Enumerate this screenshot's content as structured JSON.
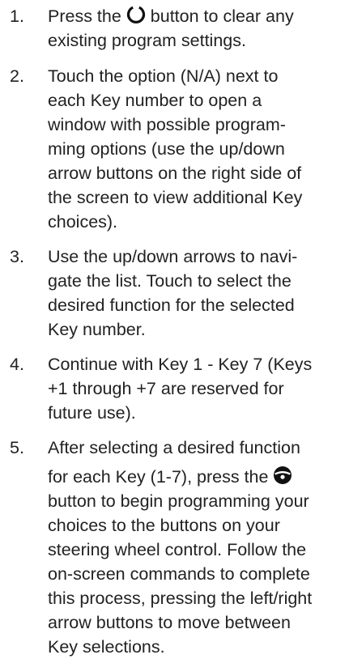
{
  "steps": [
    {
      "number": "1.",
      "before": "Press the",
      "icon": "power-icon",
      "after": "button to clear any",
      "lines": [
        "existing program settings."
      ]
    },
    {
      "number": "2.",
      "lines": [
        "Touch the option (N/A) next to",
        "each Key number to open a",
        "window with possible program-",
        "ming options (use the up/down",
        "arrow buttons on the right side of",
        "the screen to view additional Key",
        "choices)."
      ]
    },
    {
      "number": "3.",
      "lines": [
        "Use the up/down arrows to navi-",
        "gate the list. Touch to select the",
        "desired function for the selected",
        "Key number."
      ]
    },
    {
      "number": "4.",
      "lines": [
        "Continue with Key 1 - Key 7 (Keys",
        "+1 through +7 are reserved for",
        "future use)."
      ]
    },
    {
      "number": "5.",
      "first_line": "After selecting a desired function",
      "before": "for each Key (1-7), press the",
      "icon": "steering-wheel-icon",
      "lines": [
        "button to begin programming your",
        "choices to the buttons on your",
        "steering wheel control. Follow the",
        "on-screen commands to complete",
        "this process, pressing the left/right",
        "arrow buttons to move between",
        "Key selections."
      ]
    }
  ]
}
